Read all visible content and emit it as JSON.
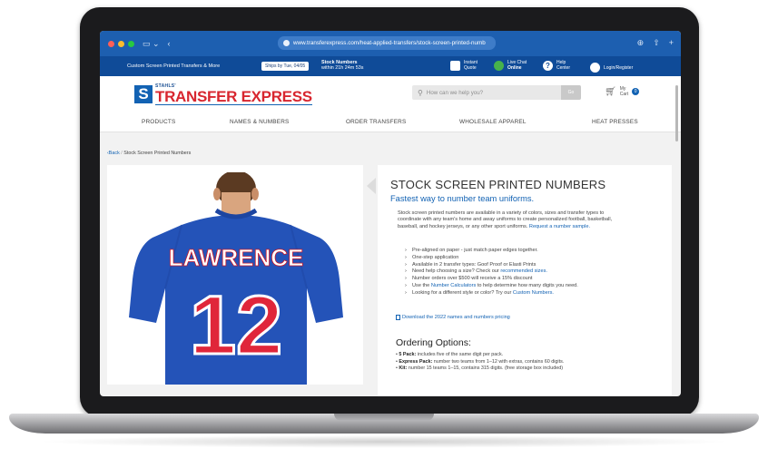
{
  "browser": {
    "url": "www.transferexpress.com/heat-applied-transfers/stock-screen-printed-numb"
  },
  "promo": {
    "left_text": "Custom Screen Printed Transfers & More",
    "ships_label": "Ships by Tue, 04/05",
    "stock_title": "Stock Numbers",
    "stock_time": "within 21h 24m 53s",
    "instant_quote_1": "Instant",
    "instant_quote_2": "Quote",
    "live_chat_1": "Live Chat",
    "live_chat_2": "Online",
    "help_1": "Help",
    "help_2": "Center",
    "login": "Login/Register"
  },
  "header": {
    "logo_small": "STAHLS'",
    "logo_big": "TRANSFER EXPRESS",
    "logo_mark": "S",
    "search_placeholder": "How can we help you?",
    "search_button": "Go",
    "cart_label_1": "My",
    "cart_label_2": "Cart",
    "cart_count": "0"
  },
  "nav": {
    "items": [
      "PRODUCTS",
      "NAMES & NUMBERS",
      "ORDER TRANSFERS",
      "WHOLESALE APPAREL",
      "HEAT PRESSES"
    ]
  },
  "breadcrumb": {
    "back": "‹Back",
    "current": "Stock Screen Printed Numbers"
  },
  "product": {
    "jersey_name": "LAWRENCE",
    "jersey_number": "12"
  },
  "description": {
    "title": "STOCK SCREEN PRINTED NUMBERS",
    "subtitle": "Fastest way to number team uniforms.",
    "para_1": "Stock screen printed numbers are available in a variety of colors, sizes and transfer types to coordinate with any team's home and away uniforms to create personalized football, basketball, baseball, and hockey jerseys, or any other sport uniforms.",
    "para_link": "Request a number sample.",
    "bullets": [
      {
        "text": "Pre-aligned on paper - just match paper edges together.",
        "link": ""
      },
      {
        "text": "One-step application",
        "link": ""
      },
      {
        "text": "Available in 2 transfer types: Goof Proof or Elasti Prints",
        "link": ""
      },
      {
        "text": "Need help choosing a size? Check our ",
        "link": "recommended sizes."
      },
      {
        "text": "Number orders over $500 will receive a 15% discount",
        "link": ""
      },
      {
        "text": "Use the ",
        "link": "Number Calculators",
        "after": " to help determine how many digits you need."
      },
      {
        "text": "Looking for a different style or color? Try our ",
        "link": "Custom Numbers."
      }
    ],
    "download": "Download the 2022 names and numbers pricing",
    "ordering_title": "Ordering Options:",
    "ordering": [
      {
        "label": "5 Pack:",
        "text": " includes five of the same digit per pack."
      },
      {
        "label": "Express Pack:",
        "text": " number two teams from 1–12 with extras, contains 60 digits."
      },
      {
        "label": "Kit:",
        "text": " number 15 teams 1–15, contains 315 digits. (free storage box included)"
      }
    ]
  },
  "colors": {
    "browser_blue": "#1d5fb0",
    "promo_blue": "#0f4b98",
    "brand_red": "#d8262f",
    "link_blue": "#1262b3",
    "jersey_blue": "#2453b8"
  }
}
